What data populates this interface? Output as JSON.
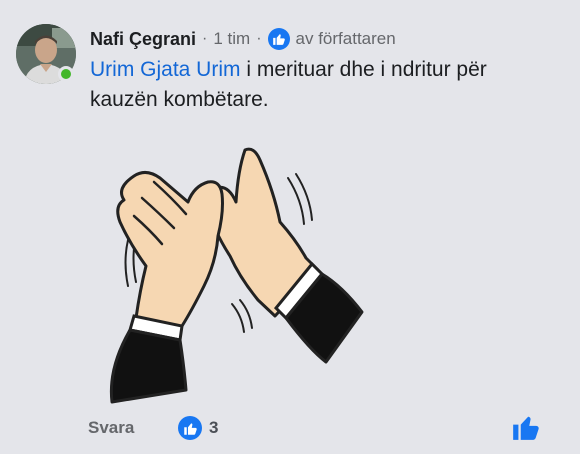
{
  "comment": {
    "author": "Nafi Çegrani",
    "separator": "·",
    "time": "1 tim",
    "author_badge": "av författaren",
    "mention": "Urim Gjata Urim",
    "text": " i merituar dhe i ndritur për kauzën kombëtare.",
    "image_icon": "clapping-hands-icon"
  },
  "footer": {
    "reply_label": "Svara",
    "reaction_count": "3",
    "reaction_icon": "thumbs-up-icon",
    "like_icon": "thumbs-up-icon"
  },
  "colors": {
    "background": "#e4e5ea",
    "mention": "#1367d6",
    "accent": "#1877f2",
    "online": "#42b72a",
    "secondary_text": "#65676b"
  }
}
